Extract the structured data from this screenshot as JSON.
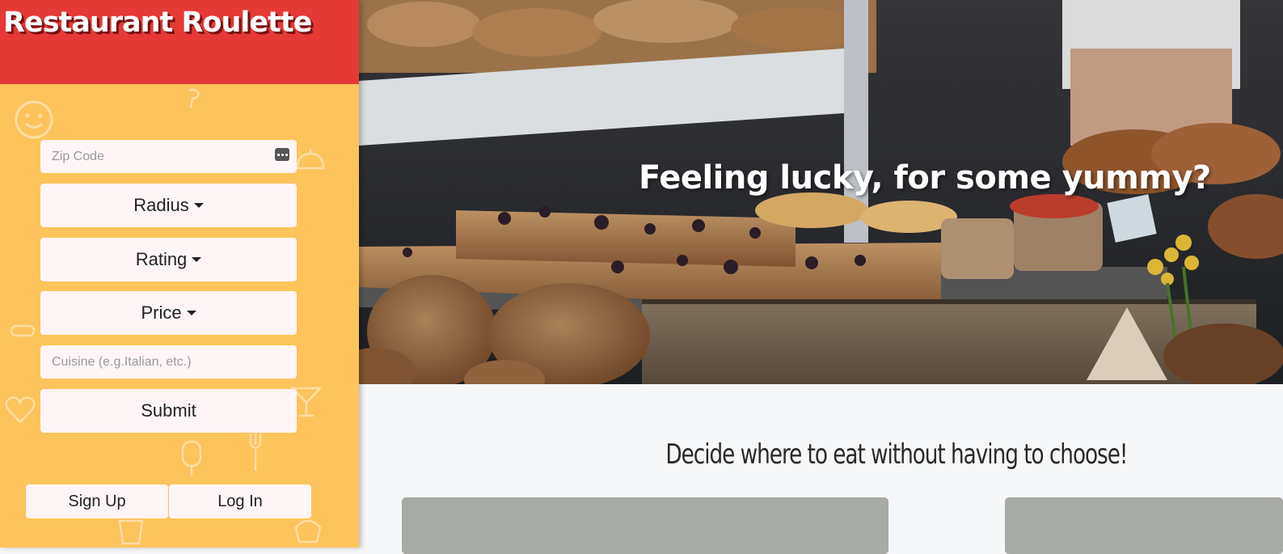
{
  "app": {
    "title": "Restaurant Roulette"
  },
  "sidebar": {
    "zip_placeholder": "Zip Code",
    "radius_label": "Radius",
    "rating_label": "Rating",
    "price_label": "Price",
    "cuisine_placeholder": "Cuisine (e.g.Italian, etc.)",
    "submit_label": "Submit",
    "signup_label": "Sign Up",
    "login_label": "Log In"
  },
  "hero": {
    "headline": "Feeling lucky, for some yummy?"
  },
  "main": {
    "tagline": "Decide where to eat without having to choose!"
  },
  "colors": {
    "brand_red": "#e53935",
    "sidebar_yellow": "#fcc45b",
    "button_bg": "#fff5f6",
    "card_gray": "#a8aaa5",
    "page_bg": "#f6f7f8"
  }
}
